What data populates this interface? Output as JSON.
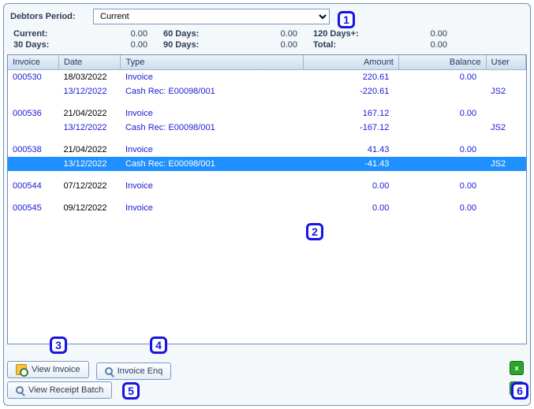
{
  "period": {
    "label": "Debtors Period:",
    "value": "Current"
  },
  "summary": {
    "current_label": "Current:",
    "current_value": "0.00",
    "d60_label": "60 Days:",
    "d60_value": "0.00",
    "d120_label": "120 Days+:",
    "d120_value": "0.00",
    "d30_label": "30 Days:",
    "d30_value": "0.00",
    "d90_label": "90 Days:",
    "d90_value": "0.00",
    "total_label": "Total:",
    "total_value": "0.00"
  },
  "columns": {
    "invoice": "Invoice",
    "date": "Date",
    "type": "Type",
    "amount": "Amount",
    "balance": "Balance",
    "user": "User"
  },
  "rows": [
    {
      "invoice": "000530",
      "date": "18/03/2022",
      "type": "Invoice",
      "amount": "220.61",
      "balance": "0.00",
      "user": "",
      "cls": "inv"
    },
    {
      "invoice": "",
      "date": "13/12/2022",
      "type": "Cash Rec: E00098/001",
      "amount": "-220.61",
      "balance": "",
      "user": "JS2",
      "cls": "rec"
    },
    {
      "spacer": true
    },
    {
      "invoice": "000536",
      "date": "21/04/2022",
      "type": "Invoice",
      "amount": "167.12",
      "balance": "0.00",
      "user": "",
      "cls": "inv"
    },
    {
      "invoice": "",
      "date": "13/12/2022",
      "type": "Cash Rec: E00098/001",
      "amount": "-167.12",
      "balance": "",
      "user": "JS2",
      "cls": "rec"
    },
    {
      "spacer": true
    },
    {
      "invoice": "000538",
      "date": "21/04/2022",
      "type": "Invoice",
      "amount": "41.43",
      "balance": "0.00",
      "user": "",
      "cls": "inv"
    },
    {
      "invoice": "",
      "date": "13/12/2022",
      "type": "Cash Rec: E00098/001",
      "amount": "-41.43",
      "balance": "",
      "user": "JS2",
      "cls": "sel"
    },
    {
      "spacer": true
    },
    {
      "invoice": "000544",
      "date": "07/12/2022",
      "type": "Invoice",
      "amount": "0.00",
      "balance": "0.00",
      "user": "",
      "cls": "inv"
    },
    {
      "spacer": true
    },
    {
      "invoice": "000545",
      "date": "09/12/2022",
      "type": "Invoice",
      "amount": "0.00",
      "balance": "0.00",
      "user": "",
      "cls": "inv"
    }
  ],
  "buttons": {
    "view_invoice": "View Invoice",
    "invoice_enq": "Invoice Enq",
    "view_receipt_batch": "View Receipt Batch",
    "export_excel": "x"
  },
  "markers": {
    "m1": "1",
    "m2": "2",
    "m3": "3",
    "m4": "4",
    "m5": "5",
    "m6": "6"
  }
}
